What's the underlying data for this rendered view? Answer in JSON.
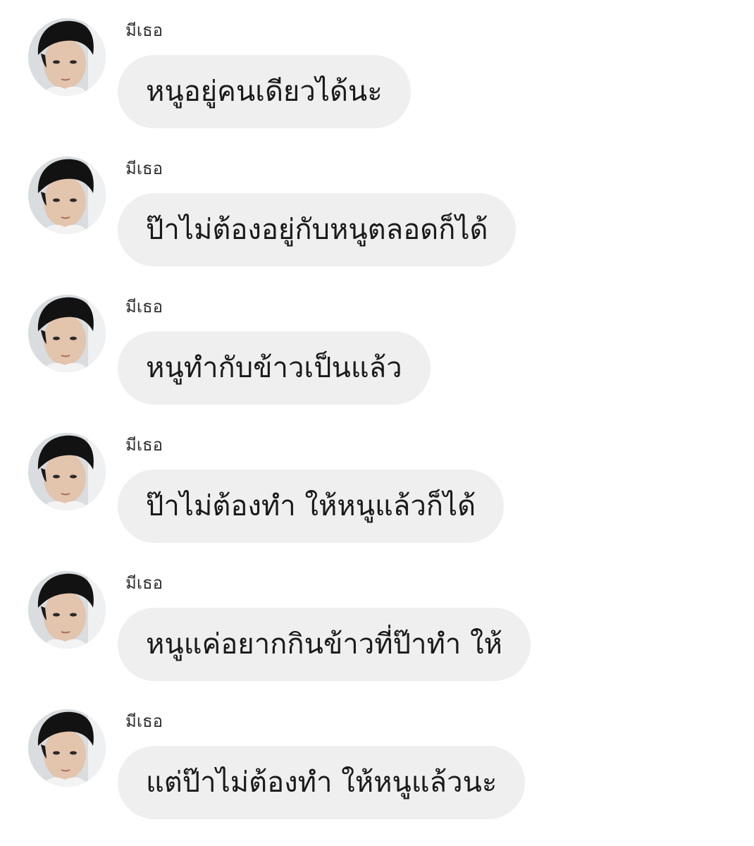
{
  "messages": [
    {
      "sender": "มีเธอ",
      "avatar_icon": "child-face-avatar",
      "text": "หนูอยู่คนเดียวได้นะ"
    },
    {
      "sender": "มีเธอ",
      "avatar_icon": "child-face-avatar",
      "text": "ป๊าไม่ต้องอยู่กับหนูตลอดก็ได้"
    },
    {
      "sender": "มีเธอ",
      "avatar_icon": "child-face-avatar",
      "text": "หนูทำกับข้าวเป็นแล้ว"
    },
    {
      "sender": "มีเธอ",
      "avatar_icon": "child-face-avatar",
      "text": "ป๊าไม่ต้องทำ ให้หนูแล้วก็ได้"
    },
    {
      "sender": "มีเธอ",
      "avatar_icon": "child-face-avatar",
      "text": "หนูแค่อยากกินข้าวที่ป๊าทำ ให้"
    },
    {
      "sender": "มีเธอ",
      "avatar_icon": "child-face-avatar",
      "text": "แต่ป๊าไม่ต้องทำ ให้หนูแล้วนะ"
    }
  ],
  "colors": {
    "background": "#ffffff",
    "bubble": "#efefef",
    "text": "#1a1a1a",
    "sender": "#303030"
  }
}
